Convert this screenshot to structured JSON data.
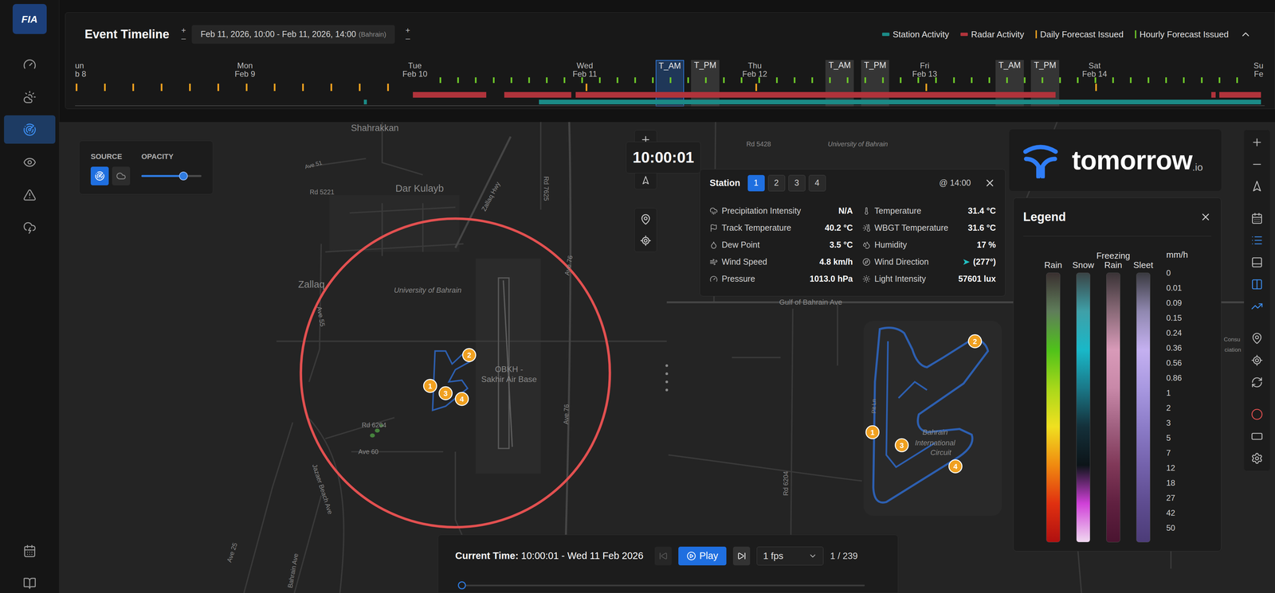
{
  "sidebar": {
    "logo": "FIA",
    "items": [
      {
        "kind": "dashboard",
        "selected": false
      },
      {
        "kind": "weather",
        "selected": false
      },
      {
        "kind": "radar",
        "selected": true
      },
      {
        "kind": "monitor",
        "selected": false
      },
      {
        "kind": "alerts",
        "selected": false
      },
      {
        "kind": "storm",
        "selected": false
      }
    ],
    "bottom_items": [
      {
        "kind": "calendar",
        "selected": false
      },
      {
        "kind": "docs",
        "selected": false
      }
    ]
  },
  "timeline": {
    "title": "Event Timeline",
    "left_stepper": {
      "up": "+",
      "down": "–"
    },
    "right_stepper": {
      "up": "+",
      "down": "–"
    },
    "range": "Feb 11, 2026, 10:00 - Feb 11, 2026, 14:00",
    "timezone": "(Bahrain)",
    "expanded": true,
    "legend": [
      {
        "label": "Station Activity",
        "kind": "swatch",
        "color": "#1b8a86"
      },
      {
        "label": "Radar Activity",
        "kind": "swatch",
        "color": "#b0333b"
      },
      {
        "label": "Daily Forecast Issued",
        "kind": "tick",
        "color": "#f0a020"
      },
      {
        "label": "Hourly Forecast Issued",
        "kind": "tick",
        "color": "#6cc42a"
      }
    ],
    "days": [
      {
        "day": "un",
        "date": "b 8"
      },
      {
        "day": "Mon",
        "date": "Feb 9"
      },
      {
        "day": "Tue",
        "date": "Feb 10"
      },
      {
        "day": "Wed",
        "date": "Feb 11"
      },
      {
        "day": "Thu",
        "date": "Feb 12"
      },
      {
        "day": "Fri",
        "date": "Feb 13"
      },
      {
        "day": "Sat",
        "date": "Feb 14"
      },
      {
        "day": "Su",
        "date": "Fe"
      }
    ],
    "sessions": [
      {
        "label": "T_AM",
        "start": 82,
        "end": 86,
        "selected": true
      },
      {
        "label": "T_PM",
        "start": 87,
        "end": 91,
        "selected": false
      },
      {
        "label": "T_AM",
        "start": 106,
        "end": 110,
        "selected": false
      },
      {
        "label": "T_PM",
        "start": 111,
        "end": 115,
        "selected": false
      },
      {
        "label": "T_AM",
        "start": 130,
        "end": 134,
        "selected": false
      },
      {
        "label": "T_PM",
        "start": 135,
        "end": 139,
        "selected": false
      }
    ],
    "daily_forecasts": [
      0,
      4,
      8,
      12,
      16,
      20,
      24,
      28,
      32,
      36,
      40,
      44,
      72,
      96,
      120,
      144
    ],
    "hourly_forecasts": [
      51.5,
      54,
      56.5,
      59,
      61.5,
      64,
      66.5,
      69,
      71.5,
      74,
      76.5,
      79,
      81.5,
      84,
      86.5,
      89,
      91.5,
      94,
      96.5,
      99,
      101.5,
      104,
      106.5,
      109,
      111.5,
      114,
      116.5,
      119,
      121.5,
      124,
      126.5,
      129,
      131.5,
      134,
      136.5,
      139,
      141.5,
      144,
      146.5,
      149,
      151.5,
      154,
      156.5,
      159,
      161.5,
      164
    ],
    "radar_activity": [
      [
        47.7,
        58.1
      ],
      [
        60.6,
        70.1
      ],
      [
        70.7,
        138.5
      ],
      [
        160.5,
        161.1
      ],
      [
        161.6,
        167.5
      ]
    ],
    "station_activity": [
      [
        40.8,
        41.2
      ],
      [
        65.5,
        167.5
      ]
    ]
  },
  "map": {
    "labels": [
      "Shahrakkan",
      "Ave 51",
      "Rd 5221",
      "Dar Kulayb",
      "Zallaq Hwy",
      "Rd 7625",
      "Rd 5428",
      "University of Bahrain",
      "University of Bahrain",
      "Zallaq",
      "Ave 55",
      "Ave 76",
      "Ave 76",
      "OBKH -",
      "Sakhir Air Base",
      "Rd 6204",
      "Ave 60",
      "Jazaer Beach Ave",
      "Ave 25",
      "Bahrain Ave",
      "Gulf of Bahrain Ave",
      "Rd 6204",
      "Pit Ln",
      "Bahrain",
      "International",
      "Circuit",
      "Consu",
      "ciation"
    ],
    "left_pins": [
      "1",
      "2",
      "3",
      "4"
    ],
    "right_pins": [
      "1",
      "2",
      "3",
      "4"
    ]
  },
  "source_panel": {
    "source_label": "SOURCE",
    "opacity_label": "OPACITY",
    "options": [
      {
        "kind": "radar",
        "selected": true
      },
      {
        "kind": "satellite",
        "selected": false
      }
    ],
    "opacity": 0.7
  },
  "clock": "10:00:01",
  "station": {
    "title": "Station",
    "tabs": [
      {
        "label": "1",
        "selected": true
      },
      {
        "label": "2",
        "selected": false
      },
      {
        "label": "3",
        "selected": false
      },
      {
        "label": "4",
        "selected": false
      }
    ],
    "time": "@ 14:00",
    "left_rows": [
      {
        "kind": "precipitation",
        "label": "Precipitation Intensity",
        "value": "N/A"
      },
      {
        "kind": "track",
        "label": "Track Temperature",
        "value": "40.2 °C"
      },
      {
        "kind": "dew",
        "label": "Dew Point",
        "value": "3.5 °C"
      },
      {
        "kind": "wind-speed",
        "label": "Wind Speed",
        "value": "4.8 km/h"
      },
      {
        "kind": "pressure",
        "label": "Pressure",
        "value": "1013.0 hPa"
      }
    ],
    "right_rows": [
      {
        "kind": "temperature",
        "label": "Temperature",
        "value": "31.4 °C"
      },
      {
        "kind": "wbgt",
        "label": "WBGT Temperature",
        "value": "31.6 °C"
      },
      {
        "kind": "humidity",
        "label": "Humidity",
        "value": "17 %"
      },
      {
        "kind": "wind-direction",
        "label": "Wind Direction",
        "value": "(277°)"
      },
      {
        "kind": "light",
        "label": "Light Intensity",
        "value": "57601 lux"
      }
    ]
  },
  "logo": {
    "name": "tomorrow",
    "suffix": ".io"
  },
  "legend": {
    "title": "Legend",
    "unit": "mm/h",
    "columns": [
      {
        "label": "Rain",
        "gradient": [
          "#3a3030",
          "#5f7d5a",
          "#4fc21a",
          "#a8d81a",
          "#f0e020",
          "#f08a10",
          "#e03010",
          "#b01010"
        ]
      },
      {
        "label": "Snow",
        "gradient": [
          "#3a4446",
          "#3fa0a8",
          "#19b8c8",
          "#1a7888",
          "#14303a",
          "#0c1418",
          "#d040d8",
          "#f0d8f0"
        ]
      },
      {
        "label": "Freezing Rain",
        "gradient": [
          "#3a3336",
          "#8a6a78",
          "#d89ab8",
          "#c888a8",
          "#a06080",
          "#803858",
          "#602040",
          "#4a1430"
        ]
      },
      {
        "label": "Sleet",
        "gradient": [
          "#3a3a40",
          "#9088b0",
          "#c4b0f0",
          "#a898e0",
          "#8c7cc8",
          "#7462ac",
          "#5e4c90",
          "#4c3c78"
        ]
      }
    ],
    "values": [
      "0",
      "0.01",
      "0.09",
      "0.15",
      "0.24",
      "0.36",
      "0.56",
      "0.86",
      "1",
      "2",
      "3",
      "5",
      "7",
      "12",
      "18",
      "27",
      "42",
      "50"
    ]
  },
  "toolbar": [
    {
      "kind": "zoom-in",
      "active": false
    },
    {
      "kind": "zoom-out",
      "active": false
    },
    {
      "kind": "north",
      "active": false
    },
    {
      "kind": "calendar",
      "active": false
    },
    {
      "kind": "layers-list",
      "active": true
    },
    {
      "kind": "panel",
      "active": false
    },
    {
      "kind": "split-view",
      "active": true
    },
    {
      "kind": "chart",
      "active": true
    },
    {
      "kind": "pin",
      "active": false
    },
    {
      "kind": "locate",
      "active": false
    },
    {
      "kind": "refresh",
      "active": false
    },
    {
      "kind": "draw-circle",
      "active": false
    },
    {
      "kind": "draw-rect",
      "active": false
    },
    {
      "kind": "settings",
      "active": false
    }
  ],
  "playback": {
    "label": "Current Time:",
    "value": "10:00:01 - Wed 11 Feb 2026",
    "play": "Play",
    "speed": "1 fps",
    "frame": "1 / 239",
    "level": 0,
    "prev_disabled": true
  }
}
